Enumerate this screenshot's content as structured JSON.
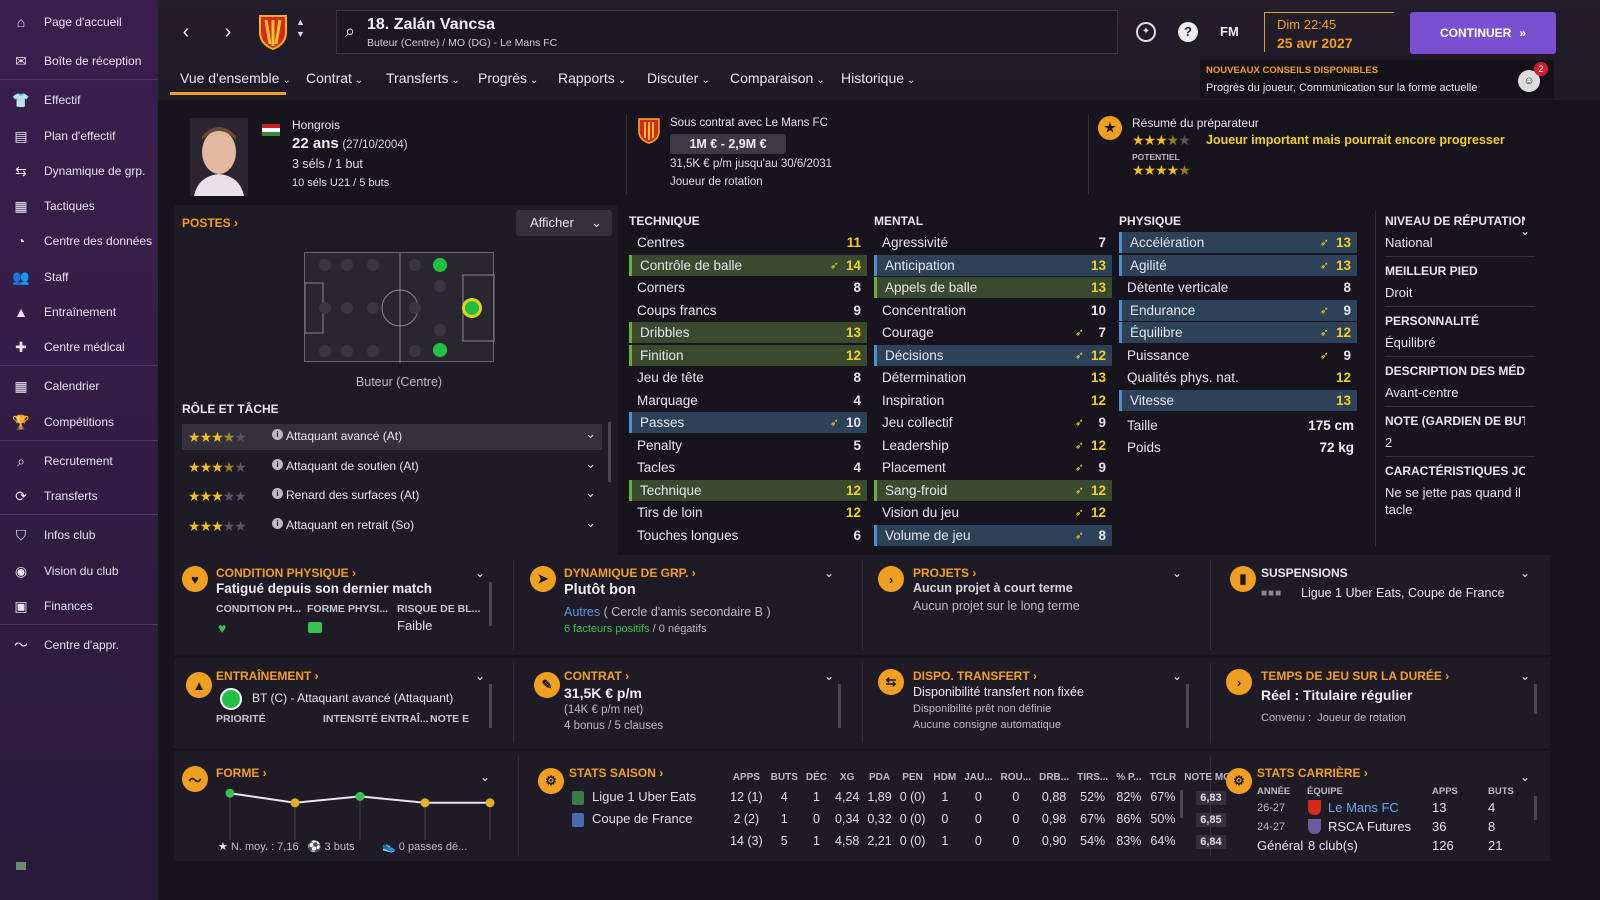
{
  "sidebar": {
    "items": [
      {
        "label": "Page d'accueil",
        "icon": "home-icon",
        "glyph": "⌂"
      },
      {
        "label": "Boîte de réception",
        "icon": "inbox-icon",
        "glyph": "✉"
      },
      {
        "label": "Effectif",
        "icon": "shirt-icon",
        "glyph": "👕"
      },
      {
        "label": "Plan d'effectif",
        "icon": "clipboard-icon",
        "glyph": "▤"
      },
      {
        "label": "Dynamique de grp.",
        "icon": "group-dynamics-icon",
        "glyph": "⇆"
      },
      {
        "label": "Tactiques",
        "icon": "tactics-icon",
        "glyph": "▦"
      },
      {
        "label": "Centre des données",
        "icon": "data-hub-icon",
        "glyph": "◔"
      },
      {
        "label": "Staff",
        "icon": "staff-icon",
        "glyph": "👥"
      },
      {
        "label": "Entraînement",
        "icon": "training-icon",
        "glyph": "▲"
      },
      {
        "label": "Centre médical",
        "icon": "medical-icon",
        "glyph": "✚"
      },
      {
        "label": "Calendrier",
        "icon": "calendar-icon",
        "glyph": "▦"
      },
      {
        "label": "Compétitions",
        "icon": "trophy-icon",
        "glyph": "🏆"
      },
      {
        "label": "Recrutement",
        "icon": "scouting-icon",
        "glyph": "⌕"
      },
      {
        "label": "Transferts",
        "icon": "transfers-icon",
        "glyph": "⟳"
      },
      {
        "label": "Infos club",
        "icon": "club-shield-icon",
        "glyph": "⛉"
      },
      {
        "label": "Vision du club",
        "icon": "vision-icon",
        "glyph": "◉"
      },
      {
        "label": "Finances",
        "icon": "finances-icon",
        "glyph": "▣"
      },
      {
        "label": "Centre d'appr.",
        "icon": "learning-icon",
        "glyph": "〜"
      }
    ]
  },
  "header": {
    "player_title": "18. Zalán Vancsa",
    "player_subtitle": "Buteur (Centre) / MO (DG) - Le Mans FC",
    "date_time": "Dim 22:45",
    "date": "25 avr 2027",
    "fm_label": "FM",
    "help_label": "?",
    "continue_label": "CONTINUER",
    "advice_title": "NOUVEAUX CONSEILS DISPONIBLES",
    "advice_text": "Progrès du joueur, Communication sur la forme actuelle",
    "advice_badge": "2"
  },
  "tabs": [
    "Vue d'ensemble",
    "Contrat",
    "Transferts",
    "Progrès",
    "Rapports",
    "Discuter",
    "Comparaison",
    "Historique"
  ],
  "bio": {
    "nationality": "Hongrois",
    "age": "22 ans",
    "dob": "(27/10/2004)",
    "caps": "3 séls / 1 but",
    "u21": "10 séls U21 / 5 buts",
    "contract_club": "Sous contrat avec Le Mans FC",
    "value": "1M € - 2,9M €",
    "wage_line": "31,5K € p/m jusqu'au 30/6/2031",
    "role_status": "Joueur de rotation",
    "coach_summary_label": "Résumé du préparateur",
    "coach_summary": "Joueur important mais pourrait encore progresser",
    "potential_label": "POTENTIEL",
    "ability_stars": 3.5,
    "potential_stars": 4.5
  },
  "positions": {
    "title": "POSTES",
    "display_btn": "Afficher",
    "position_name": "Buteur (Centre)",
    "roles_title": "RÔLE ET TÂCHE",
    "roles": [
      {
        "name": "Attaquant avancé (At)",
        "stars": 3.5
      },
      {
        "name": "Attaquant de soutien (At)",
        "stars": 3.5
      },
      {
        "name": "Renard des surfaces (At)",
        "stars": 3
      },
      {
        "name": "Attaquant en retrait (So)",
        "stars": 3
      }
    ]
  },
  "attributes": {
    "technique_title": "TECHNIQUE",
    "mental_title": "MENTAL",
    "physique_title": "PHYSIQUE",
    "technique": [
      {
        "name": "Centres",
        "value": "11",
        "hl": "",
        "arrow": false,
        "yellow": true
      },
      {
        "name": "Contrôle de balle",
        "value": "14",
        "hl": "green",
        "arrow": true,
        "yellow": true
      },
      {
        "name": "Corners",
        "value": "8",
        "hl": "",
        "arrow": false,
        "yellow": false
      },
      {
        "name": "Coups francs",
        "value": "9",
        "hl": "",
        "arrow": false,
        "yellow": false
      },
      {
        "name": "Dribbles",
        "value": "13",
        "hl": "green",
        "arrow": false,
        "yellow": true
      },
      {
        "name": "Finition",
        "value": "12",
        "hl": "green",
        "arrow": false,
        "yellow": true
      },
      {
        "name": "Jeu de tête",
        "value": "8",
        "hl": "",
        "arrow": false,
        "yellow": false
      },
      {
        "name": "Marquage",
        "value": "4",
        "hl": "",
        "arrow": false,
        "yellow": false
      },
      {
        "name": "Passes",
        "value": "10",
        "hl": "blue",
        "arrow": true,
        "yellow": false
      },
      {
        "name": "Penalty",
        "value": "5",
        "hl": "",
        "arrow": false,
        "yellow": false
      },
      {
        "name": "Tacles",
        "value": "4",
        "hl": "",
        "arrow": false,
        "yellow": false
      },
      {
        "name": "Technique",
        "value": "12",
        "hl": "green",
        "arrow": false,
        "yellow": true
      },
      {
        "name": "Tirs de loin",
        "value": "12",
        "hl": "",
        "arrow": false,
        "yellow": true
      },
      {
        "name": "Touches longues",
        "value": "6",
        "hl": "",
        "arrow": false,
        "yellow": false
      }
    ],
    "mental": [
      {
        "name": "Agressivité",
        "value": "7",
        "hl": "",
        "arrow": false,
        "yellow": false
      },
      {
        "name": "Anticipation",
        "value": "13",
        "hl": "blue",
        "arrow": false,
        "yellow": true
      },
      {
        "name": "Appels de balle",
        "value": "13",
        "hl": "green",
        "arrow": false,
        "yellow": true
      },
      {
        "name": "Concentration",
        "value": "10",
        "hl": "",
        "arrow": false,
        "yellow": false
      },
      {
        "name": "Courage",
        "value": "7",
        "hl": "",
        "arrow": true,
        "yellow": false
      },
      {
        "name": "Décisions",
        "value": "12",
        "hl": "blue",
        "arrow": true,
        "yellow": true
      },
      {
        "name": "Détermination",
        "value": "13",
        "hl": "",
        "arrow": false,
        "yellow": true
      },
      {
        "name": "Inspiration",
        "value": "12",
        "hl": "",
        "arrow": false,
        "yellow": true
      },
      {
        "name": "Jeu collectif",
        "value": "9",
        "hl": "",
        "arrow": true,
        "yellow": false
      },
      {
        "name": "Leadership",
        "value": "12",
        "hl": "",
        "arrow": true,
        "yellow": true
      },
      {
        "name": "Placement",
        "value": "9",
        "hl": "",
        "arrow": true,
        "yellow": false
      },
      {
        "name": "Sang-froid",
        "value": "12",
        "hl": "green",
        "arrow": true,
        "yellow": true
      },
      {
        "name": "Vision du jeu",
        "value": "12",
        "hl": "",
        "arrow": true,
        "yellow": true
      },
      {
        "name": "Volume de jeu",
        "value": "8",
        "hl": "blue",
        "arrow": true,
        "yellow": false
      }
    ],
    "physique": [
      {
        "name": "Accélération",
        "value": "13",
        "hl": "blue",
        "arrow": true,
        "yellow": true
      },
      {
        "name": "Agilité",
        "value": "13",
        "hl": "blue",
        "arrow": true,
        "yellow": true
      },
      {
        "name": "Détente verticale",
        "value": "8",
        "hl": "",
        "arrow": false,
        "yellow": false
      },
      {
        "name": "Endurance",
        "value": "9",
        "hl": "blue",
        "arrow": true,
        "yellow": false
      },
      {
        "name": "Équilibre",
        "value": "12",
        "hl": "blue",
        "arrow": true,
        "yellow": true
      },
      {
        "name": "Puissance",
        "value": "9",
        "hl": "",
        "arrow": true,
        "yellow": false
      },
      {
        "name": "Qualités phys. nat.",
        "value": "12",
        "hl": "",
        "arrow": false,
        "yellow": true
      },
      {
        "name": "Vitesse",
        "value": "13",
        "hl": "blue",
        "arrow": false,
        "yellow": true
      }
    ],
    "height_label": "Taille",
    "height": "175 cm",
    "weight_label": "Poids",
    "weight": "72 kg"
  },
  "side_info": [
    {
      "h": "NIVEAU DE RÉPUTATION",
      "v": "National"
    },
    {
      "h": "MEILLEUR PIED",
      "v": "Droit"
    },
    {
      "h": "PERSONNALITÉ",
      "v": "Équilibré"
    },
    {
      "h": "DESCRIPTION DES MÉDI...",
      "v": "Avant-centre"
    },
    {
      "h": "NOTE (GARDIEN DE BUT)",
      "v": "2"
    },
    {
      "h": "CARACTÉRISTIQUES JOUEU",
      "v": "Ne se jette pas quand il tacle"
    }
  ],
  "cards": {
    "condition": {
      "title": "CONDITION PHYSIQUE",
      "main": "Fatigué depuis son dernier match",
      "c1": "CONDITION PH...",
      "c2": "FORME PHYSI...",
      "c3": "RISQUE DE BL...",
      "c3v": "Faible"
    },
    "dynamics": {
      "title": "DYNAMIQUE DE GRP.",
      "main": "Plutôt bon",
      "group": "Autres",
      "circle": "( Cercle d'amis secondaire B )",
      "pos": "6 facteurs positifs",
      "neg": "0 négatifs",
      "sep": "/"
    },
    "projects": {
      "title": "PROJETS",
      "l1": "Aucun projet à court terme",
      "l2": "Aucun projet sur le long terme"
    },
    "suspensions": {
      "title": "SUSPENSIONS",
      "text": "Ligue 1 Uber Eats, Coupe de France"
    },
    "training": {
      "title": "ENTRAÎNEMENT",
      "main": "BT (C) - Attaquant avancé (Attaquant)",
      "c1": "PRIORITÉ",
      "c2": "INTENSITÉ ENTRAÎ...",
      "c3": "NOTE E"
    },
    "contract": {
      "title": "CONTRAT",
      "main": "31,5K € p/m",
      "net": "(14K € p/m net)",
      "bonus": "4 bonus / 5 clauses"
    },
    "transfer": {
      "title": "DISPO. TRANSFERT",
      "main": "Disponibilité transfert non fixée",
      "l1": "Disponibilité prêt non définie",
      "l2": "Aucune consigne automatique"
    },
    "playtime": {
      "title": "TEMPS DE JEU SUR LA DURÉE",
      "main": "Réel : Titulaire régulier",
      "agreed": "Convenu :  Joueur de rotation"
    }
  },
  "form": {
    "title": "FORME",
    "avg": "N. moy. : 7,16",
    "goals": "3 buts",
    "assists": "0 passes dé...",
    "points": [
      0.8,
      0.2,
      0.6,
      0.2,
      0.2
    ]
  },
  "season_stats": {
    "title": "STATS SAISON",
    "headers": [
      "APPS",
      "BUTS",
      "DÉC",
      "XG",
      "PDA",
      "PEN",
      "HDM",
      "JAU...",
      "ROU...",
      "DRB...",
      "TIRS...",
      "% P...",
      "TCLR",
      "NOTE MOY"
    ],
    "rows": [
      {
        "comp": "Ligue 1 Uber Eats",
        "vals": [
          "12 (1)",
          "4",
          "1",
          "4,24",
          "1,89",
          "0 (0)",
          "1",
          "0",
          "0",
          "0,88",
          "52%",
          "82%",
          "67%",
          "6,83"
        ]
      },
      {
        "comp": "Coupe de France",
        "vals": [
          "2 (2)",
          "1",
          "0",
          "0,34",
          "0,32",
          "0 (0)",
          "0",
          "0",
          "0",
          "0,98",
          "67%",
          "86%",
          "50%",
          "6,85"
        ]
      },
      {
        "comp": "",
        "vals": [
          "14 (3)",
          "5",
          "1",
          "4,58",
          "2,21",
          "0 (0)",
          "1",
          "0",
          "0",
          "0,90",
          "54%",
          "83%",
          "64%",
          "6,84"
        ]
      }
    ]
  },
  "career_stats": {
    "title": "STATS CARRIÈRE",
    "headers": [
      "ANNÉE",
      "ÉQUIPE",
      "APPS",
      "BUTS"
    ],
    "rows": [
      {
        "year": "26-27",
        "team": "Le Mans FC",
        "apps": "13",
        "goals": "4"
      },
      {
        "year": "24-27",
        "team": "RSCA Futures",
        "apps": "36",
        "goals": "8"
      }
    ],
    "total_label": "Général",
    "total_clubs": "8 club(s)",
    "total_apps": "126",
    "total_goals": "21"
  },
  "colors": {
    "accent": "#f0a020",
    "purple": "#7a4fd0",
    "green": "#6cae3a",
    "blue": "#4d8fc8"
  }
}
